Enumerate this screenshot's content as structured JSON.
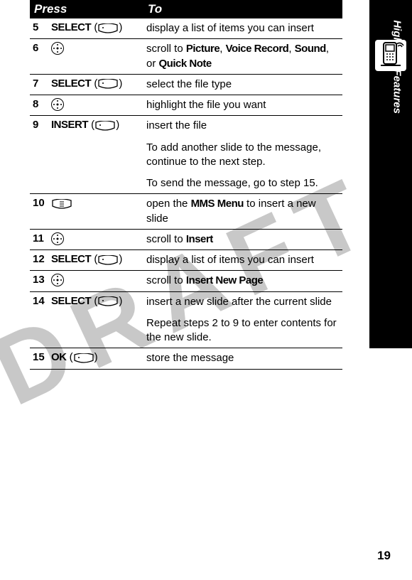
{
  "watermark": "DRAFT",
  "side_label": "Highlight Features",
  "page_number": "19",
  "header": {
    "press": "Press",
    "to": "To"
  },
  "rows": {
    "r5": {
      "step": "5",
      "cmd": "SELECT",
      "desc": "display a list of items you can insert"
    },
    "r6": {
      "step": "6",
      "desc_prefix": "scroll to ",
      "opt1": "Picture",
      "opt2": "Voice Record",
      "opt3": "Sound",
      "opt4": "Quick Note",
      "comma": ", ",
      "or": ", or "
    },
    "r7": {
      "step": "7",
      "cmd": "SELECT",
      "desc": "select the file type"
    },
    "r8": {
      "step": "8",
      "desc": "highlight the file you want"
    },
    "r9": {
      "step": "9",
      "cmd": "INSERT",
      "desc": "insert the file",
      "sub1": "To add another slide to the message, continue to the next step.",
      "sub2": "To send the message, go to step 15."
    },
    "r10": {
      "step": "10",
      "desc_prefix": "open the ",
      "menu": "MMS Menu",
      "desc_suffix": " to insert a new slide"
    },
    "r11": {
      "step": "11",
      "desc_prefix": "scroll to ",
      "target": "Insert"
    },
    "r12": {
      "step": "12",
      "cmd": "SELECT",
      "desc": "display a list of items you can insert"
    },
    "r13": {
      "step": "13",
      "desc_prefix": "scroll to ",
      "target": "Insert New Page"
    },
    "r14": {
      "step": "14",
      "cmd": "SELECT",
      "desc": "insert a new slide after the current slide",
      "sub1": "Repeat steps 2 to 9 to enter contents for the new slide."
    },
    "r15": {
      "step": "15",
      "cmd": "OK",
      "desc": "store the message"
    }
  }
}
